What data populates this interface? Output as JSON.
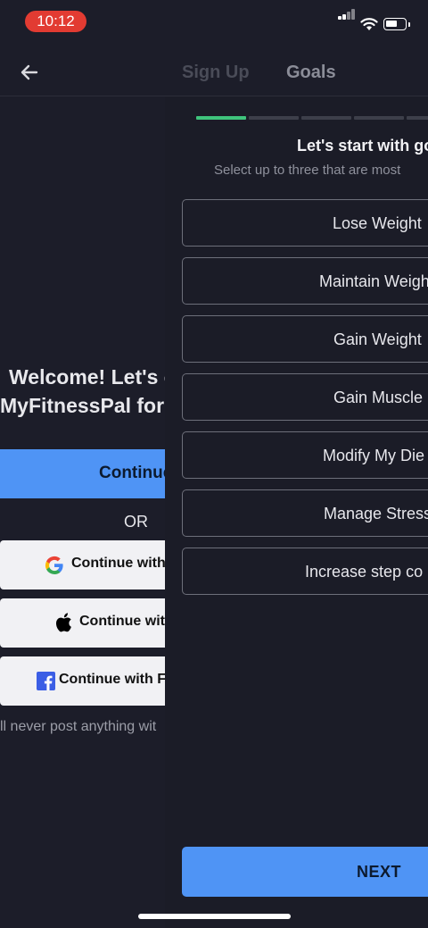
{
  "status_bar": {
    "time": "10:12"
  },
  "header": {
    "back_icon": "arrow-left-icon",
    "tabs": [
      {
        "label": "Sign Up"
      },
      {
        "label": "Goals"
      }
    ]
  },
  "background_screen": {
    "welcome_line1": "Welcome! Let's c",
    "welcome_line2": "MyFitnessPal for",
    "continue_label": "Continue",
    "or_label": "OR",
    "google_label": "Continue with",
    "apple_label": "Continue wit",
    "facebook_label": "Continue with F",
    "disclaimer": "ll never post anything wit"
  },
  "goals_screen": {
    "title": "Let's start with go",
    "subtitle": "Select up to three that are most",
    "options": [
      {
        "label": "Lose Weight"
      },
      {
        "label": "Maintain Weigh"
      },
      {
        "label": "Gain Weight"
      },
      {
        "label": "Gain Muscle"
      },
      {
        "label": "Modify My Die"
      },
      {
        "label": "Manage Stress"
      },
      {
        "label": "Increase step co"
      }
    ],
    "next_label": "NEXT",
    "progress": {
      "completed_steps": 1,
      "visible_steps": 5
    }
  },
  "colors": {
    "accent": "#4f94f5",
    "progress_active": "#3fc47c",
    "background": "#1c1d29",
    "time_pill": "#e23b32"
  }
}
